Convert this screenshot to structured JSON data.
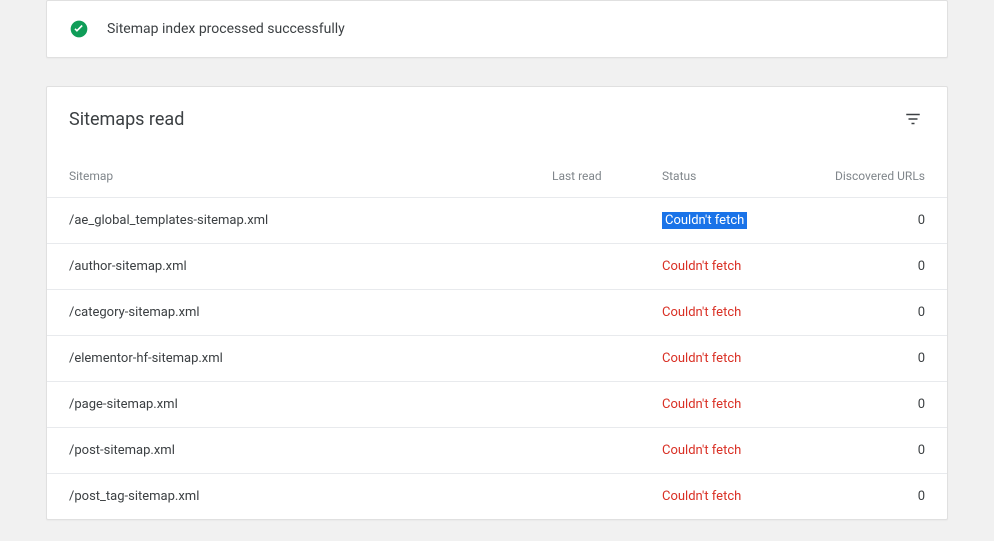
{
  "banner": {
    "message": "Sitemap index processed successfully"
  },
  "card": {
    "title": "Sitemaps read"
  },
  "table": {
    "headers": {
      "sitemap": "Sitemap",
      "last_read": "Last read",
      "status": "Status",
      "discovered": "Discovered URLs"
    },
    "rows": [
      {
        "sitemap": "/ae_global_templates-sitemap.xml",
        "last_read": "",
        "status": "Couldn't fetch",
        "discovered": "0",
        "selected": true
      },
      {
        "sitemap": "/author-sitemap.xml",
        "last_read": "",
        "status": "Couldn't fetch",
        "discovered": "0",
        "selected": false
      },
      {
        "sitemap": "/category-sitemap.xml",
        "last_read": "",
        "status": "Couldn't fetch",
        "discovered": "0",
        "selected": false
      },
      {
        "sitemap": "/elementor-hf-sitemap.xml",
        "last_read": "",
        "status": "Couldn't fetch",
        "discovered": "0",
        "selected": false
      },
      {
        "sitemap": "/page-sitemap.xml",
        "last_read": "",
        "status": "Couldn't fetch",
        "discovered": "0",
        "selected": false
      },
      {
        "sitemap": "/post-sitemap.xml",
        "last_read": "",
        "status": "Couldn't fetch",
        "discovered": "0",
        "selected": false
      },
      {
        "sitemap": "/post_tag-sitemap.xml",
        "last_read": "",
        "status": "Couldn't fetch",
        "discovered": "0",
        "selected": false
      }
    ]
  }
}
